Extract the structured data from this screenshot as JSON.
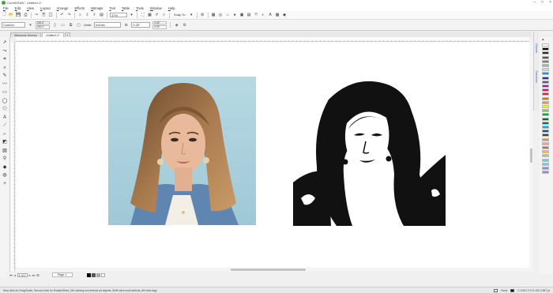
{
  "titlebar": {
    "title": "CorelDRAW - Untitled-1*"
  },
  "menu": [
    "File",
    "Edit",
    "View",
    "Layout",
    "Arrange",
    "Effects",
    "Bitmaps",
    "Text",
    "Table",
    "Tools",
    "Window",
    "Help"
  ],
  "toolbar": {
    "zoom": "37%",
    "snap": "Snap To"
  },
  "propbar": {
    "size_preset": "Custom",
    "width": "200.0\"",
    "height": "200.0\"",
    "units_label": "Units:",
    "units": "inches",
    "nudge": "0.25\"",
    "dup_x": "0.25\"",
    "dup_y": "0.25\""
  },
  "tabs": [
    {
      "label": "Welcome Screen"
    },
    {
      "label": "Untitled-1*"
    }
  ],
  "docker_tabs": [
    "Objects",
    "Transform"
  ],
  "pagenav": {
    "page_counter": "1 of 1",
    "page_tab": "Page 1"
  },
  "status": {
    "hint": "Next click for Drag/Scale; Second click for Rotate/Skew; Dbl-clicking tool selects all objects; Shift+click multi-selects; Alt+click digs",
    "fill_label": "None",
    "color_info": "C:0 M:0 Y:0 K:100  0.567 pt"
  },
  "palette": [
    "#ffffff",
    "#000000",
    "#2b2b2b",
    "#555555",
    "#808080",
    "#aaaaaa",
    "#d5d5d5",
    "#00a0e3",
    "#2e3192",
    "#6b4c9a",
    "#92278f",
    "#ec008c",
    "#ed1c24",
    "#f26522",
    "#f7941d",
    "#fff200",
    "#8dc63f",
    "#00a651",
    "#006838",
    "#00746b",
    "#00aeef",
    "#0054a6",
    "#603913",
    "#c69c6d",
    "#f49ac1",
    "#a67c52",
    "#fbaf5d",
    "#acd373",
    "#7accc8",
    "#6dcff6",
    "#8393ca",
    "#a186be"
  ],
  "colors": {
    "accent": "#2f6cc4",
    "canvas": "#ffffff",
    "photo_bg": "#a9cfdc"
  }
}
